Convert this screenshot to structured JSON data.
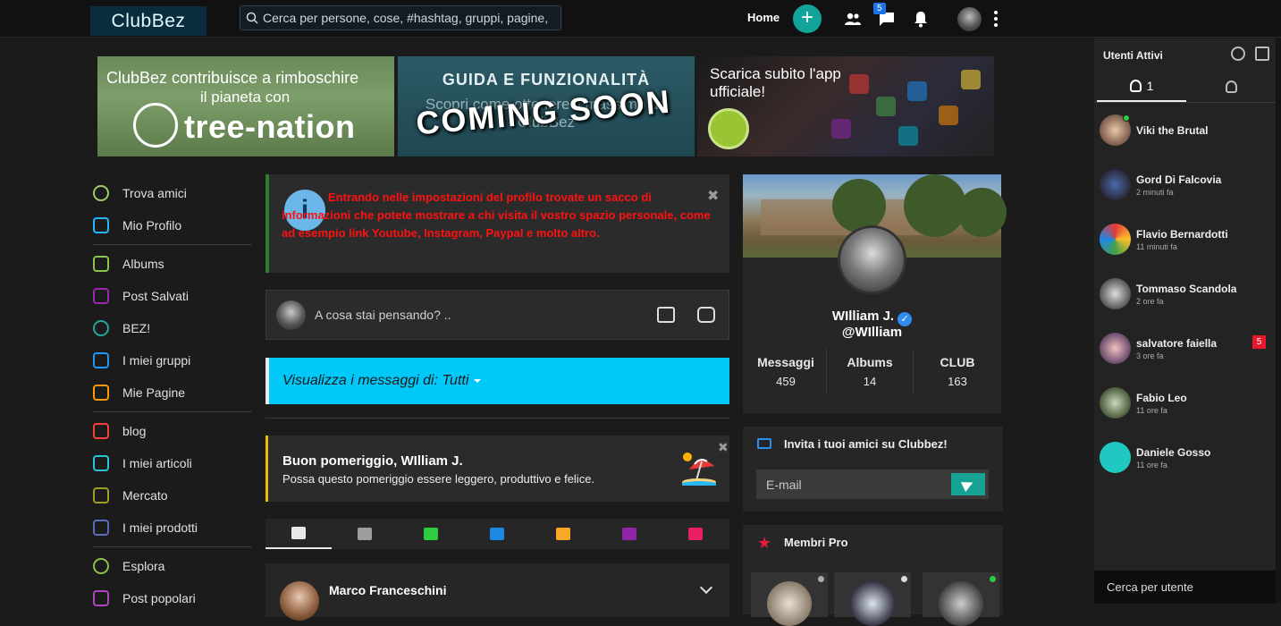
{
  "header": {
    "logo_text": "ClubBez",
    "search_placeholder": "Cerca per persone, cose, #hashtag, gruppi, pagine,",
    "home_label": "Home",
    "plus_label": "+",
    "messages_badge": "5"
  },
  "banners": {
    "tree_nation": {
      "line1": "ClubBez contribuisce a rimboschire",
      "line2": "il pianeta con",
      "brand": "tree-nation"
    },
    "guide": {
      "title": "GUIDA E FUNZIONALITÀ",
      "subtitle": "Scopri come ottenere il massimo da ClubBez",
      "overlay": "COMING SOON"
    },
    "app": {
      "text_line1": "Scarica subito l'app",
      "text_line2": "ufficiale!"
    }
  },
  "left_nav": {
    "items": [
      {
        "label": "Trova amici",
        "icon": "map-pin-icon",
        "color": "#9ccc65"
      },
      {
        "label": "Mio Profilo",
        "icon": "user-icon",
        "color": "#29b6f6"
      },
      {
        "label": "Albums",
        "icon": "image-icon",
        "color": "#8bc34a"
      },
      {
        "label": "Post Salvati",
        "icon": "bookmark-icon",
        "color": "#9c27b0"
      },
      {
        "label": "BEZ!",
        "icon": "target-icon",
        "color": "#26a69a"
      },
      {
        "label": "I miei gruppi",
        "icon": "grid-icon",
        "color": "#2196f3"
      },
      {
        "label": "Mie Pagine",
        "icon": "flag-icon",
        "color": "#ff9800"
      },
      {
        "label": "blog",
        "icon": "book-icon",
        "color": "#f44336"
      },
      {
        "label": "I miei articoli",
        "icon": "open-book-icon",
        "color": "#26c6da"
      },
      {
        "label": "Mercato",
        "icon": "bag-icon",
        "color": "#9e9d24"
      },
      {
        "label": "I miei prodotti",
        "icon": "cart-icon",
        "color": "#5c6bc0"
      },
      {
        "label": "Esplora",
        "icon": "search-icon",
        "color": "#8bc34a"
      },
      {
        "label": "Post popolari",
        "icon": "document-icon",
        "color": "#ab47bc"
      }
    ]
  },
  "info_alert": {
    "text": "Entrando nelle impostazioni del profilo trovate un sacco di informazioni che potete mostrare a chi visita il vostro spazio personale, come ad esempio link Youtube, Instagram, Paypal e molto altro.",
    "icon_glyph": "i",
    "close_glyph": "✖"
  },
  "composer": {
    "placeholder": "A cosa stai pensando? .."
  },
  "filter": {
    "label": "Visualizza i messaggi di: ",
    "value": "Tutti"
  },
  "greeting": {
    "title": "Buon pomeriggio, WIlliam J.",
    "subtitle": "Possa questo pomeriggio essere leggero, produttivo e felice.",
    "close_glyph": "✖"
  },
  "post_tabs": [
    {
      "icon": "news-feed-icon",
      "color": "#e8e8e8"
    },
    {
      "icon": "text-lines-icon",
      "color": "#9e9e9e"
    },
    {
      "icon": "photo-icon",
      "color": "#2ecc40"
    },
    {
      "icon": "video-camera-icon",
      "color": "#1e88e5"
    },
    {
      "icon": "music-note-icon",
      "color": "#f9a825"
    },
    {
      "icon": "file-icon",
      "color": "#8e24aa"
    },
    {
      "icon": "map-icon",
      "color": "#e91e63"
    }
  ],
  "post": {
    "author": "Marco Franceschini"
  },
  "profile": {
    "name": "WIlliam J.",
    "handle": "@WIlliam",
    "verified_glyph": "✓",
    "stats": [
      {
        "label": "Messaggi",
        "value": "459"
      },
      {
        "label": "Albums",
        "value": "14"
      },
      {
        "label": "CLUB",
        "value": "163"
      }
    ]
  },
  "invite": {
    "title": "Invita i tuoi amici su Clubbez!",
    "placeholder": "E-mail"
  },
  "pro_members": {
    "title": "Membri Pro",
    "star_glyph": "★"
  },
  "active_users": {
    "title": "Utenti Attivi",
    "online_count": "1",
    "search_placeholder": "Cerca per utente",
    "users": [
      {
        "name": "Viki the Brutal",
        "time": "",
        "online": true,
        "badge": ""
      },
      {
        "name": "Gord Di Falcovia",
        "time": "2 minuti fa",
        "online": false,
        "badge": ""
      },
      {
        "name": "Flavio Bernardotti",
        "time": "11 minuti fa",
        "online": false,
        "badge": ""
      },
      {
        "name": "Tommaso Scandola",
        "time": "2 ore fa",
        "online": false,
        "badge": ""
      },
      {
        "name": "salvatore faiella",
        "time": "3 ore fa",
        "online": false,
        "badge": "5"
      },
      {
        "name": "Fabio Leo",
        "time": "11 ore fa",
        "online": false,
        "badge": ""
      },
      {
        "name": "Daniele Gosso",
        "time": "11 ore fa",
        "online": false,
        "badge": ""
      }
    ]
  }
}
